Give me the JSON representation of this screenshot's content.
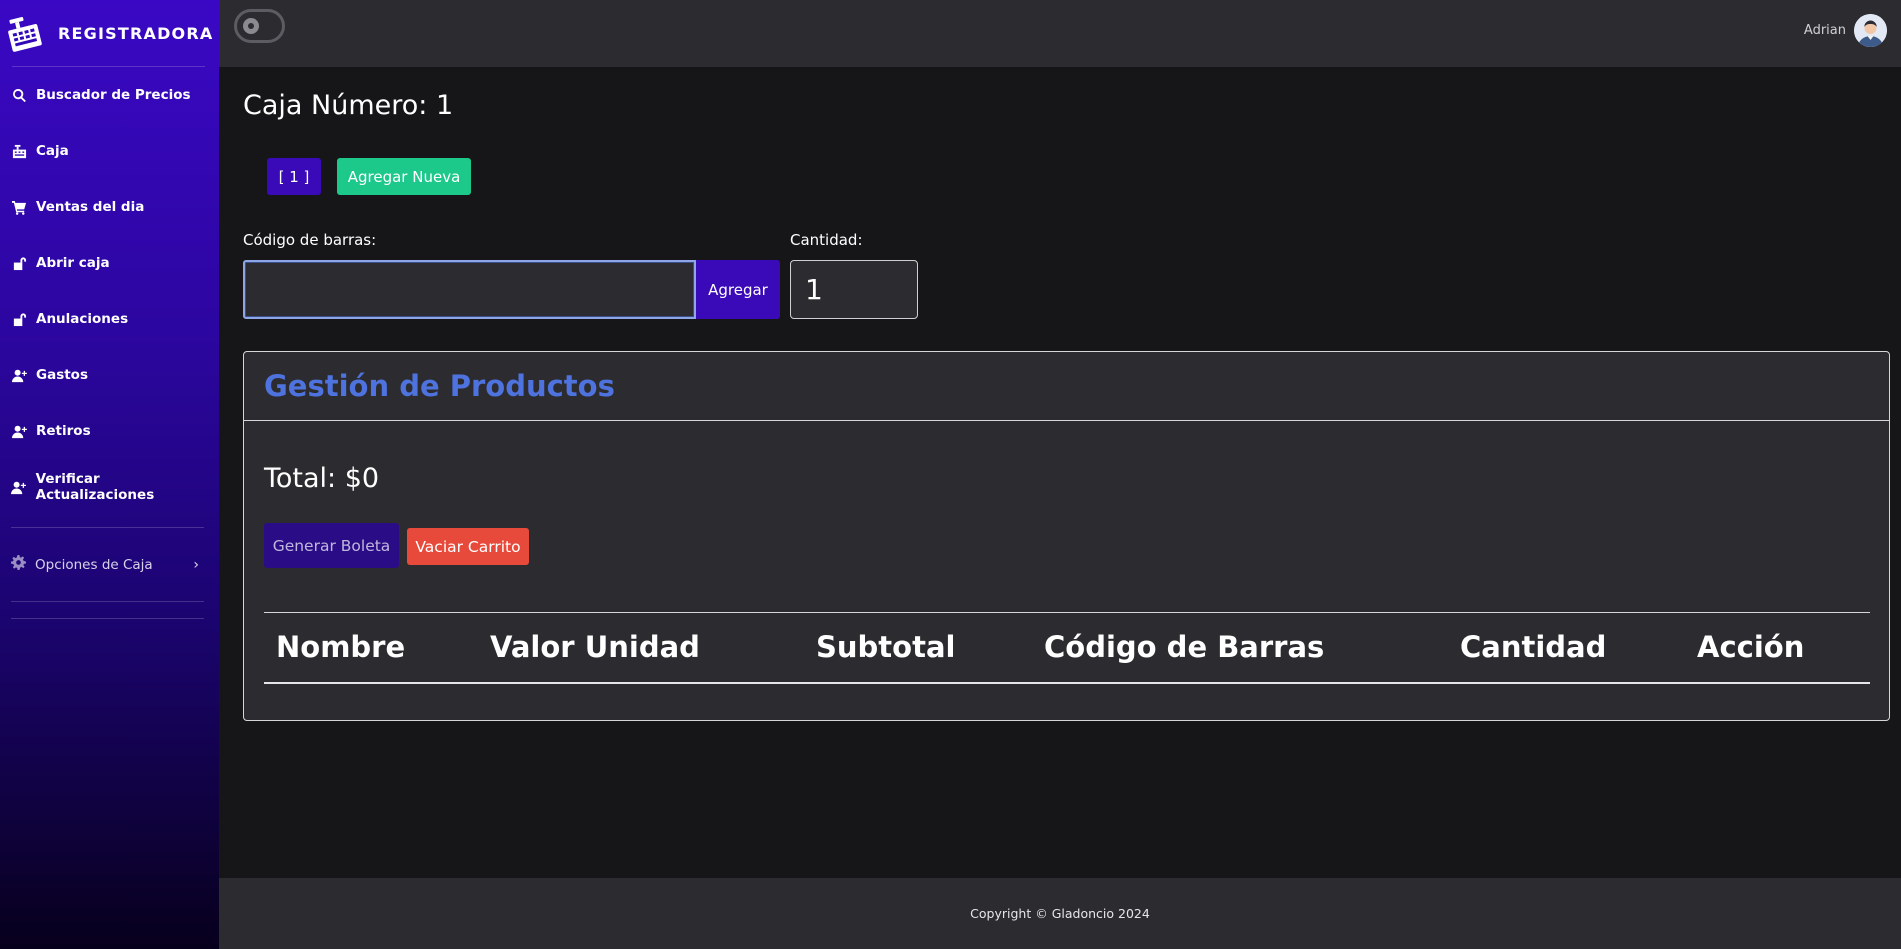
{
  "sidebar": {
    "brand": "REGISTRADORA",
    "brand_icon": "cash-register-icon",
    "items": [
      {
        "label": "Buscador de Precios",
        "icon": "search-icon"
      },
      {
        "label": "Caja",
        "icon": "cash-register-icon"
      },
      {
        "label": "Ventas del dia",
        "icon": "cart-icon"
      },
      {
        "label": "Abrir caja",
        "icon": "unlock-icon"
      },
      {
        "label": "Anulaciones",
        "icon": "unlock-icon"
      },
      {
        "label": "Gastos",
        "icon": "user-plus-icon"
      },
      {
        "label": "Retiros",
        "icon": "user-plus-icon"
      },
      {
        "label": "Verificar Actualizaciones",
        "icon": "user-plus-icon"
      }
    ],
    "options": {
      "label": "Opciones de Caja",
      "icon": "gear-icon",
      "chevron": "›"
    }
  },
  "topbar": {
    "theme_toggle_icon": "theme-toggle-icon",
    "user_name": "Adrian",
    "avatar_icon": "avatar"
  },
  "main": {
    "title": "Caja Número: 1",
    "cash_tab_label": "[ 1 ]",
    "add_new_label": "Agregar Nueva",
    "barcode_label": "Código de barras:",
    "barcode_value": "",
    "add_label": "Agregar",
    "quantity_label": "Cantidad:",
    "quantity_value": "1"
  },
  "card": {
    "title": "Gestión de Productos",
    "total": "Total: $0",
    "generate_label": "Generar Boleta",
    "empty_cart_label": "Vaciar Carrito",
    "columns": [
      "Nombre",
      "Valor Unidad",
      "Subtotal",
      "Código de Barras",
      "Cantidad",
      "Acción"
    ]
  },
  "footer": {
    "text": "Copyright © Gladoncio 2024"
  },
  "colors": {
    "accent": "#3a0ab8",
    "success": "#1cc88a",
    "danger": "#e74a3b",
    "title_blue": "#4e73df"
  }
}
